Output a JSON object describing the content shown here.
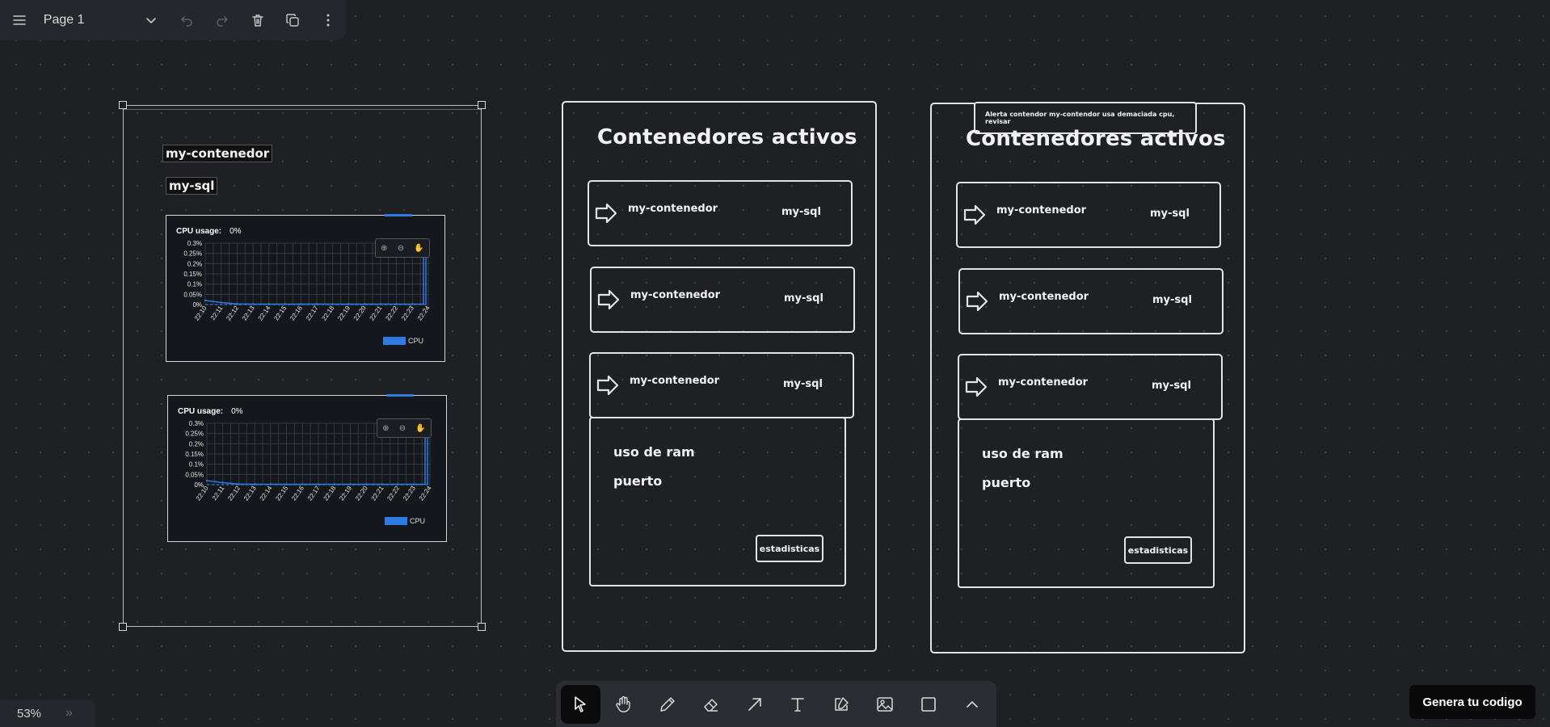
{
  "topbar": {
    "page_name": "Page 1"
  },
  "selection": {
    "tags": [
      "my-contenedor",
      "my-sql"
    ],
    "charts": [
      {
        "title": "CPU usage:",
        "value": "0%",
        "legend": "CPU"
      },
      {
        "title": "CPU usage:",
        "value": "0%",
        "legend": "CPU"
      }
    ]
  },
  "chart_data": [
    {
      "type": "line",
      "title": "CPU usage:  0%",
      "categories": [
        "22:10",
        "22:11",
        "22:12",
        "22:13",
        "22:14",
        "22:15",
        "22:16",
        "22:17",
        "22:18",
        "22:19",
        "22:20",
        "22:21",
        "22:22",
        "22:23",
        "22:24"
      ],
      "yticks": [
        "0.3%",
        "0.25%",
        "0.2%",
        "0.15%",
        "0.1%",
        "0.05%",
        "0%"
      ],
      "ylim": [
        0,
        0.3
      ],
      "series": [
        {
          "name": "CPU",
          "values": [
            0.02,
            0.01,
            0.003,
            0.002,
            0.002,
            0.002,
            0.002,
            0.002,
            0.002,
            0.002,
            0.002,
            0.002,
            0.002,
            0.002,
            0.24
          ]
        }
      ],
      "legend": "bottom-right",
      "grid": true
    },
    {
      "type": "line",
      "title": "CPU usage:  0%",
      "categories": [
        "22:10",
        "22:11",
        "22:12",
        "22:13",
        "22:14",
        "22:15",
        "22:16",
        "22:17",
        "22:18",
        "22:19",
        "22:20",
        "22:21",
        "22:22",
        "22:23",
        "22:24"
      ],
      "yticks": [
        "0.3%",
        "0.25%",
        "0.2%",
        "0.15%",
        "0.1%",
        "0.05%",
        "0%"
      ],
      "ylim": [
        0,
        0.3
      ],
      "series": [
        {
          "name": "CPU",
          "values": [
            0.02,
            0.01,
            0.003,
            0.002,
            0.002,
            0.002,
            0.002,
            0.002,
            0.002,
            0.002,
            0.002,
            0.002,
            0.002,
            0.002,
            0.24
          ]
        }
      ],
      "legend": "bottom-right",
      "grid": true
    }
  ],
  "phone1": {
    "title": "Contenedores activos",
    "rows": [
      {
        "name": "my-contenedor",
        "db": "my-sql"
      },
      {
        "name": "my-contenedor",
        "db": "my-sql"
      },
      {
        "name": "my-contenedor",
        "db": "my-sql"
      }
    ],
    "detail": {
      "line1": "uso de ram",
      "line2": "puerto",
      "button": "estadisticas"
    }
  },
  "phone2": {
    "alert": "Alerta contendor my-contendor usa demaciada cpu, revisar",
    "title": "Contenedores activos",
    "rows": [
      {
        "name": "my-contenedor",
        "db": "my-sql"
      },
      {
        "name": "my-contenedor",
        "db": "my-sql"
      },
      {
        "name": "my-contenedor",
        "db": "my-sql"
      }
    ],
    "detail": {
      "line1": "uso de ram",
      "line2": "puerto",
      "button": "estadisticas"
    }
  },
  "toolbar": {
    "tools": [
      "select-icon",
      "hand-icon",
      "pencil-icon",
      "eraser-icon",
      "arrow-icon",
      "text-icon",
      "note-icon",
      "image-icon",
      "rectangle-icon",
      "chevron-up-icon"
    ],
    "active": "select-icon"
  },
  "zoom": "53%",
  "cta": "Genera tu codigo",
  "colors": {
    "background": "#1e2024",
    "series": "#2d7be3",
    "stroke": "#e4e4e4"
  }
}
